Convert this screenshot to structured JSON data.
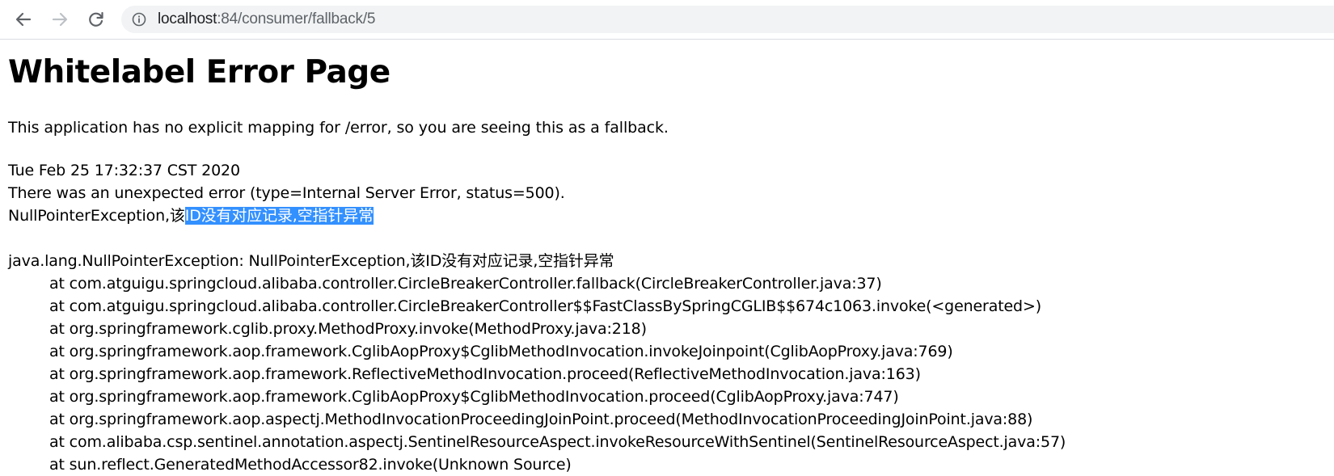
{
  "browser": {
    "url_host": "localhost",
    "url_path": ":84/consumer/fallback/5",
    "back_icon": "arrow-left-icon",
    "forward_icon": "arrow-right-icon",
    "reload_icon": "reload-icon",
    "info_icon": "info-icon"
  },
  "page": {
    "title": "Whitelabel Error Page",
    "description": "This application has no explicit mapping for /error, so you are seeing this as a fallback.",
    "timestamp": "Tue Feb 25 17:32:37 CST 2020",
    "error_summary": "There was an unexpected error (type=Internal Server Error, status=500).",
    "message_prefix": "NullPointerException,该",
    "message_selected": "ID没有对应记录,空指针异常",
    "exception_line": "java.lang.NullPointerException: NullPointerException,该ID没有对应记录,空指针异常",
    "stack_frames": [
      "at com.atguigu.springcloud.alibaba.controller.CircleBreakerController.fallback(CircleBreakerController.java:37)",
      "at com.atguigu.springcloud.alibaba.controller.CircleBreakerController$$FastClassBySpringCGLIB$$674c1063.invoke(<generated>)",
      "at org.springframework.cglib.proxy.MethodProxy.invoke(MethodProxy.java:218)",
      "at org.springframework.aop.framework.CglibAopProxy$CglibMethodInvocation.invokeJoinpoint(CglibAopProxy.java:769)",
      "at org.springframework.aop.framework.ReflectiveMethodInvocation.proceed(ReflectiveMethodInvocation.java:163)",
      "at org.springframework.aop.framework.CglibAopProxy$CglibMethodInvocation.proceed(CglibAopProxy.java:747)",
      "at org.springframework.aop.aspectj.MethodInvocationProceedingJoinPoint.proceed(MethodInvocationProceedingJoinPoint.java:88)",
      "at com.alibaba.csp.sentinel.annotation.aspectj.SentinelResourceAspect.invokeResourceWithSentinel(SentinelResourceAspect.java:57)",
      "at sun.reflect.GeneratedMethodAccessor82.invoke(Unknown Source)"
    ]
  },
  "colors": {
    "selection": "#3390ff",
    "omnibox": "#f1f3f4"
  }
}
